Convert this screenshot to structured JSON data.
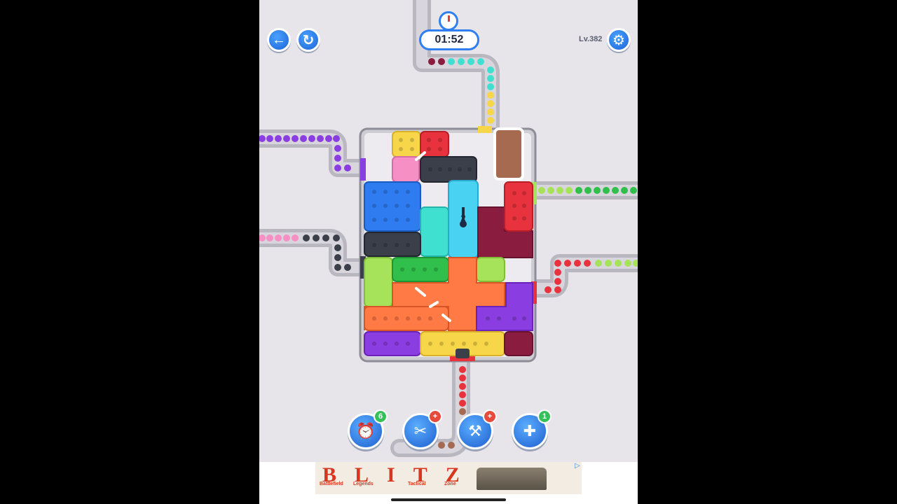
{
  "hud": {
    "timer": "01:52",
    "level": "Lv.382",
    "back_icon": "back-arrow-icon",
    "restart_icon": "restart-icon",
    "settings_icon": "gear-icon"
  },
  "board": {
    "key_block_count": "2",
    "colors": {
      "yellow": "#f7d64a",
      "red": "#e8323d",
      "pink": "#f58fc4",
      "dark": "#3a3f4a",
      "brown": "#a56a50",
      "blue": "#2f7cf0",
      "cyan": "#3fe0d0",
      "ice": "#4ad2f2",
      "maroon": "#8a1d3f",
      "lime": "#a6e35a",
      "green": "#2fbf4a",
      "orange": "#ff7a45",
      "purple": "#8a3de0"
    }
  },
  "boosters": [
    {
      "name": "add-time",
      "icon": "alarm-clock-icon",
      "badge": "6"
    },
    {
      "name": "saw",
      "icon": "saw-icon",
      "badge": "+"
    },
    {
      "name": "hammer",
      "icon": "hammer-icon",
      "badge": "+"
    },
    {
      "name": "shuffle",
      "icon": "frame-plus-icon",
      "badge": "1"
    }
  ],
  "ad": {
    "brand": "BLITZ",
    "col1_title": "Battlefield",
    "col2_title": "Legends",
    "col3_title": "Tactical",
    "col4_title": "Zone",
    "info": "▷"
  }
}
